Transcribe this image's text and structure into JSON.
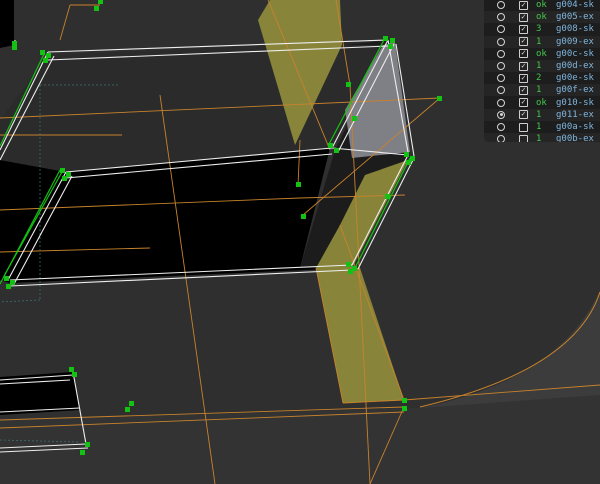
{
  "app": "3d-viewport-edit-mode",
  "colors": {
    "background": "#2f2f2f",
    "selected_face": "#8d8a3c",
    "edge_orange": "#c8822c",
    "vertex_green": "#13c213",
    "selection_white": "#eeeeee",
    "outliner_bg": "#1d1d1d",
    "outliner_name": "#7fb6e0",
    "outliner_status": "#43c84a"
  },
  "outliner": {
    "rows": [
      {
        "visibility": "radio",
        "checked": true,
        "status": "ok",
        "name": "g004-sk"
      },
      {
        "visibility": "radio",
        "checked": true,
        "status": "ok",
        "name": "g005-ex"
      },
      {
        "visibility": "radio",
        "checked": true,
        "status": "3",
        "name": "g008-sk"
      },
      {
        "visibility": "radio",
        "checked": true,
        "status": "1",
        "name": "g009-ex"
      },
      {
        "visibility": "radio",
        "checked": true,
        "status": "ok",
        "name": "g00c-sk"
      },
      {
        "visibility": "radio",
        "checked": true,
        "status": "1",
        "name": "g00d-ex"
      },
      {
        "visibility": "radio",
        "checked": true,
        "status": "2",
        "name": "g00e-sk"
      },
      {
        "visibility": "radio",
        "checked": true,
        "status": "1",
        "name": "g00f-ex"
      },
      {
        "visibility": "radio",
        "checked": true,
        "status": "ok",
        "name": "g010-sk"
      },
      {
        "visibility": "radio-active",
        "checked": true,
        "status": "1",
        "name": "g011-ex"
      },
      {
        "visibility": "radio",
        "checked": false,
        "status": "1",
        "name": "g00a-sk"
      },
      {
        "visibility": "radio",
        "checked": false,
        "status": "1",
        "name": "g00b-ex"
      }
    ]
  }
}
